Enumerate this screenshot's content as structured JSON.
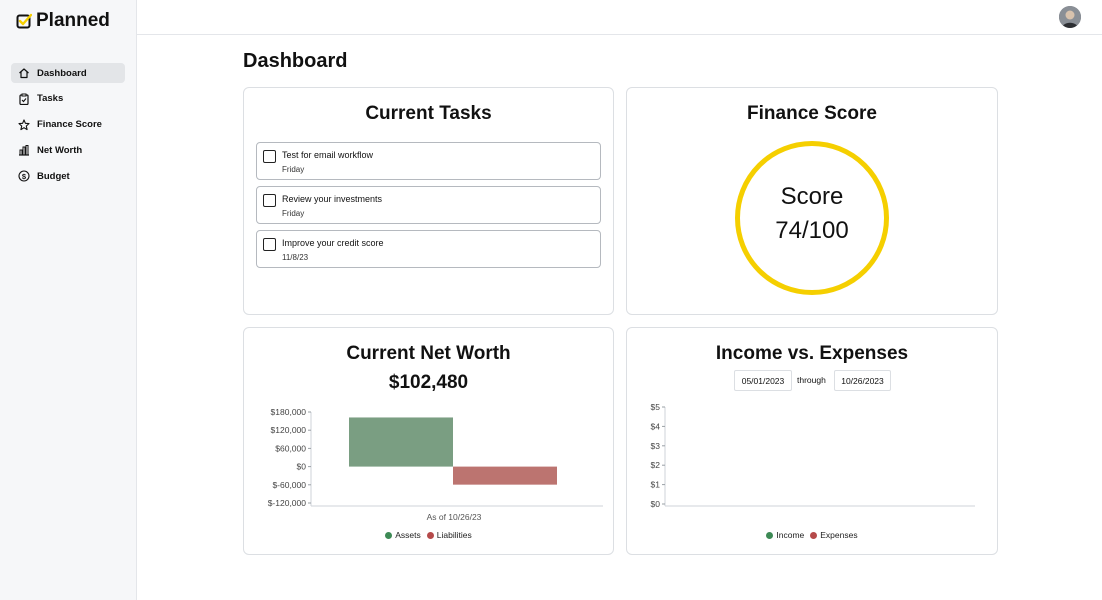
{
  "brand": {
    "name": "Planned",
    "color": "#f5cf00"
  },
  "sidebar": {
    "items": [
      {
        "label": "Dashboard",
        "icon": "home-icon",
        "active": true
      },
      {
        "label": "Tasks",
        "icon": "clipboard-check-icon",
        "active": false
      },
      {
        "label": "Finance Score",
        "icon": "star-icon",
        "active": false
      },
      {
        "label": "Net Worth",
        "icon": "bar-chart-icon",
        "active": false
      },
      {
        "label": "Budget",
        "icon": "dollar-circle-icon",
        "active": false
      }
    ]
  },
  "header": {
    "avatar": "user-avatar"
  },
  "page": {
    "title": "Dashboard"
  },
  "tasks_card": {
    "title": "Current Tasks",
    "tasks": [
      {
        "title": "Test for email workflow",
        "date": "Friday",
        "done": false
      },
      {
        "title": "Review your investments",
        "date": "Friday",
        "done": false
      },
      {
        "title": "Improve your credit score",
        "date": "11/8/23",
        "done": false
      }
    ]
  },
  "score_card": {
    "title": "Finance Score",
    "label": "Score",
    "value": "74/100",
    "score": 74,
    "max": 100,
    "ring_color": "#f5cf00"
  },
  "networth_card": {
    "title": "Current Net Worth",
    "value": "$102,480",
    "caption": "As of 10/26/23",
    "legend": [
      {
        "label": "Assets",
        "color": "#3d8a55"
      },
      {
        "label": "Liabilities",
        "color": "#b54a4a"
      }
    ]
  },
  "income_card": {
    "title": "Income vs. Expenses",
    "start_date": "05/01/2023",
    "through": "through",
    "end_date": "10/26/2023",
    "legend": [
      {
        "label": "Income",
        "color": "#3d8a55"
      },
      {
        "label": "Expenses",
        "color": "#b54a4a"
      }
    ]
  },
  "chart_data": [
    {
      "type": "bar",
      "categories": [
        "As of 10/26/23"
      ],
      "series": [
        {
          "name": "Assets",
          "values": [
            162000
          ],
          "color": "#7a9e82"
        },
        {
          "name": "Liabilities",
          "values": [
            -59520
          ],
          "color": "#bc7470"
        }
      ],
      "title": "",
      "xlabel": "",
      "ylabel": "",
      "ylim": [
        -120000,
        180000
      ],
      "yticks": [
        180000,
        120000,
        60000,
        0,
        -60000,
        -120000
      ],
      "ytick_labels": [
        "$180,000",
        "$120,000",
        "$60,000",
        "$0",
        "$-60,000",
        "$-120,000"
      ],
      "grid": false,
      "legend": "bottom"
    },
    {
      "type": "line",
      "x": [],
      "series": [
        {
          "name": "Income",
          "values": [],
          "color": "#3d8a55"
        },
        {
          "name": "Expenses",
          "values": [],
          "color": "#b54a4a"
        }
      ],
      "title": "",
      "xlabel": "",
      "ylabel": "",
      "ylim": [
        0,
        5
      ],
      "yticks": [
        5,
        4,
        3,
        2,
        1,
        0
      ],
      "ytick_labels": [
        "$5",
        "$4",
        "$3",
        "$2",
        "$1",
        "$0"
      ],
      "grid": false,
      "legend": "bottom"
    }
  ]
}
